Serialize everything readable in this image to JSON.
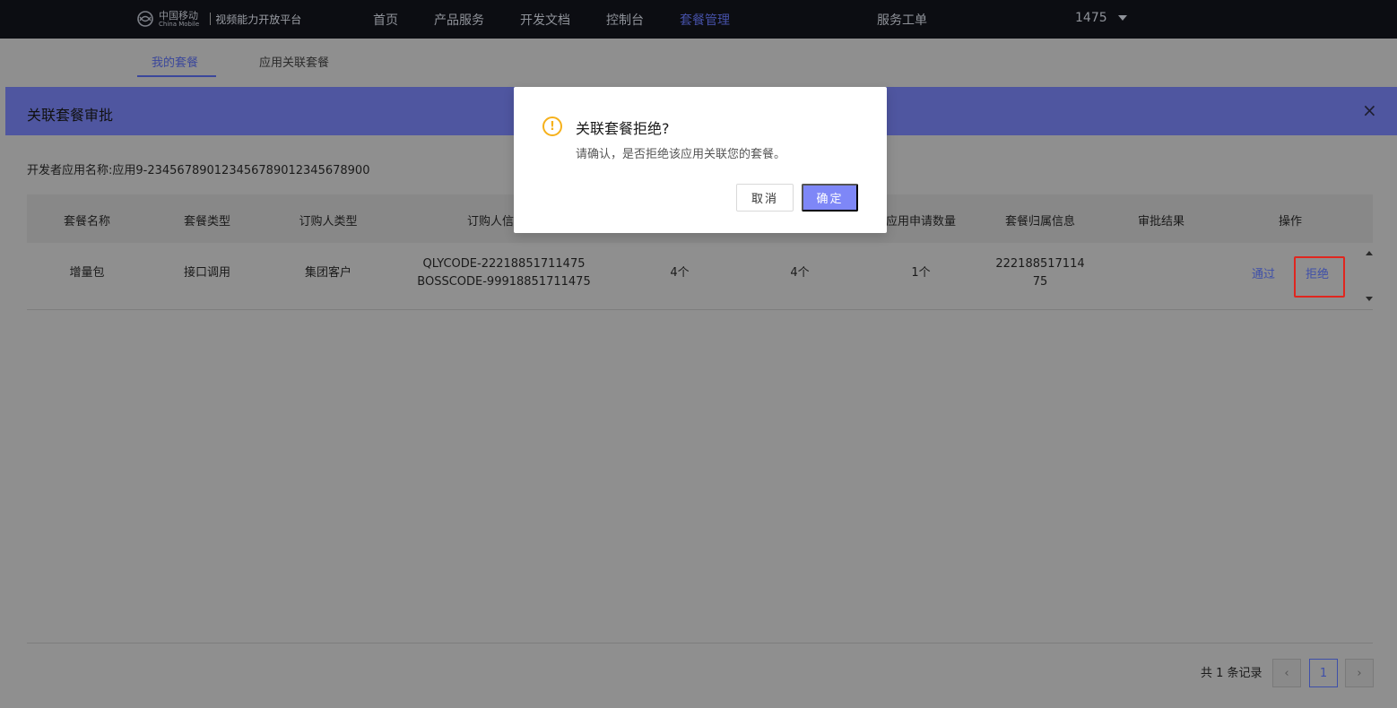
{
  "nav": {
    "logo_cn": "中国移动",
    "logo_en": "China Mobile",
    "platform": "视频能力开放平台",
    "items": [
      "首页",
      "产品服务",
      "开发文档",
      "控制台",
      "套餐管理",
      "服务工单"
    ],
    "active_item": "套餐管理",
    "user": "1475"
  },
  "tabs": {
    "items": [
      "我的套餐",
      "应用关联套餐"
    ],
    "active": "我的套餐"
  },
  "panel": {
    "title": "关联套餐审批",
    "close": "×",
    "app_name": "开发者应用名称:应用9-23456789012345678901234567890​0",
    "columns": [
      "套餐名称",
      "套餐类型",
      "订购人类型",
      "订购人信",
      "应用申请数量",
      "套餐归属信息",
      "审批结果",
      "操作"
    ],
    "row": {
      "name": "增量包",
      "type": "接口调用",
      "buyer_type": "集团客户",
      "buyer_info_1": "QLYCODE-22218851711475",
      "buyer_info_2": "BOSSCODE-99918851711475",
      "col5": "4个",
      "col6": "4个",
      "apply_count": "1个",
      "owner_1": "222188517114",
      "owner_2": "75",
      "result": "",
      "approve": "通过",
      "reject": "拒绝"
    },
    "pagination": {
      "total": "共 1 条记录",
      "prev": "‹",
      "page": "1",
      "next": "›"
    }
  },
  "dialog": {
    "icon": "!",
    "title": "关联套餐拒绝?",
    "content": "请确认，是否拒绝该应用关联您的套餐。",
    "cancel": "取消",
    "ok": "确定"
  },
  "colors": {
    "nav_bg": "#0c0d12",
    "panel_header": "#4f56a0",
    "accent": "#3e4fa9",
    "ok_button": "#7e87f7",
    "warning": "#f6b11b",
    "highlight_box": "#e0261f"
  }
}
